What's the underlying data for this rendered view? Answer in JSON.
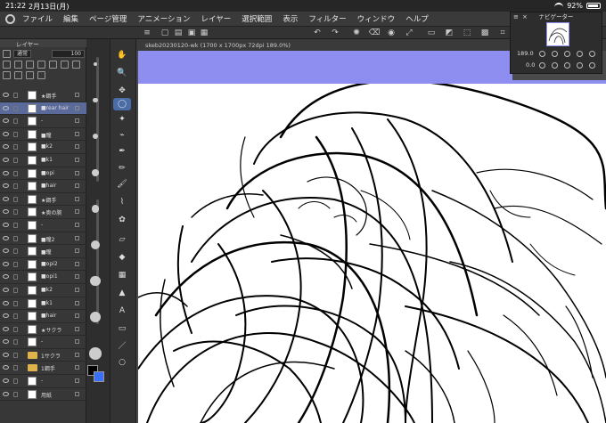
{
  "status": {
    "time": "21:22",
    "date": "2月13日(月)",
    "battery": "92%",
    "battery_level": 0.92
  },
  "menu": [
    "ファイル",
    "編集",
    "ページ管理",
    "アニメーション",
    "レイヤー",
    "選択範囲",
    "表示",
    "フィルター",
    "ウィンドウ",
    "ヘルプ"
  ],
  "layer_panel": {
    "tab_label": "レイヤー",
    "blend_mode": "通常",
    "opacity": "100",
    "layers": [
      {
        "name": "★鋼手",
        "type": "layer",
        "selected": false
      },
      {
        "name": "■rear hair",
        "type": "layer",
        "selected": true
      },
      {
        "name": "-",
        "type": "layer",
        "selected": false
      },
      {
        "name": "■瞳",
        "type": "layer",
        "selected": false
      },
      {
        "name": "■k2",
        "type": "layer",
        "selected": false
      },
      {
        "name": "■k1",
        "type": "layer",
        "selected": false
      },
      {
        "name": "■opi",
        "type": "layer",
        "selected": false
      },
      {
        "name": "■hair",
        "type": "layer",
        "selected": false
      },
      {
        "name": "★鋼手",
        "type": "layer",
        "selected": false
      },
      {
        "name": "★奥の腕",
        "type": "layer",
        "selected": false
      },
      {
        "name": "-",
        "type": "layer",
        "selected": false
      },
      {
        "name": "■瞳2",
        "type": "layer",
        "selected": false
      },
      {
        "name": "■瞳",
        "type": "layer",
        "selected": false
      },
      {
        "name": "■opi2",
        "type": "layer",
        "selected": false
      },
      {
        "name": "■opi1",
        "type": "layer",
        "selected": false
      },
      {
        "name": "■k2",
        "type": "layer",
        "selected": false
      },
      {
        "name": "■k1",
        "type": "layer",
        "selected": false
      },
      {
        "name": "■hair",
        "type": "layer",
        "selected": false
      },
      {
        "name": "★サクラ",
        "type": "layer",
        "selected": false
      },
      {
        "name": "-",
        "type": "layer",
        "selected": false
      },
      {
        "name": "1サクラ",
        "type": "folder",
        "selected": false
      },
      {
        "name": "1鋼手",
        "type": "folder",
        "selected": false
      },
      {
        "name": "-",
        "type": "layer",
        "selected": false
      },
      {
        "name": "用紙",
        "type": "layer",
        "selected": false
      }
    ]
  },
  "document": {
    "tab_title": "skeb20230120-wk (1700 x 1700px 72dpi 189.0%)"
  },
  "navigator": {
    "title": "ナビゲーター",
    "zoom": "189.0",
    "rotation": "0.0"
  },
  "colors": {
    "accent": "#4a6da8",
    "canvas_bg": "#8d8ef0",
    "fg_color": "#000000",
    "bg_color": "#3a6ff7"
  }
}
